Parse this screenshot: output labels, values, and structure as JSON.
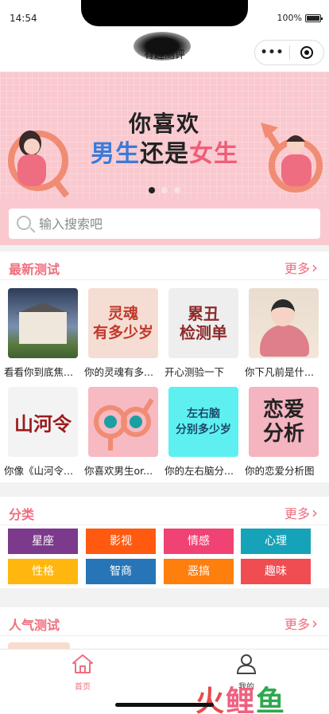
{
  "status": {
    "time": "14:54",
    "battery": "100%"
  },
  "nav": {
    "title": "有趣测评",
    "more_icon": "more-dots-icon",
    "close_icon": "target-circle-icon"
  },
  "banner": {
    "line1": "你喜欢",
    "line2": {
      "a": "男生",
      "b": "还是",
      "c": "女生"
    },
    "page_count": 3,
    "active_index": 0
  },
  "search": {
    "placeholder": "输入搜索吧",
    "value": ""
  },
  "latest": {
    "title": "最新测试",
    "more": "更多",
    "items": [
      {
        "caption": "看看你到底焦...",
        "thumb_text": ""
      },
      {
        "caption": "你的灵魂有多...",
        "thumb_text": "灵魂\n有多少岁"
      },
      {
        "caption": "开心测验一下",
        "thumb_text": "累丑\n检测单"
      },
      {
        "caption": "你下凡前是什...",
        "thumb_text": ""
      },
      {
        "caption": "你像《山河令...",
        "thumb_text": "山河令"
      },
      {
        "caption": "你喜欢男生or...",
        "thumb_text": ""
      },
      {
        "caption": "你的左右脑分...",
        "thumb_text": "左右脑\n分别多少岁"
      },
      {
        "caption": "你的恋爱分析图",
        "thumb_text": "恋爱\n分析"
      }
    ]
  },
  "category": {
    "title": "分类",
    "more": "更多",
    "items": [
      {
        "label": "星座",
        "color": "#7b3a8b"
      },
      {
        "label": "影视",
        "color": "#ff5a10"
      },
      {
        "label": "情感",
        "color": "#f04273"
      },
      {
        "label": "心理",
        "color": "#16a2b8"
      },
      {
        "label": "性格",
        "color": "#ffb70f"
      },
      {
        "label": "智商",
        "color": "#2775b6"
      },
      {
        "label": "恶搞",
        "color": "#ff7f0e"
      },
      {
        "label": "趣味",
        "color": "#ef4d52"
      }
    ]
  },
  "popular": {
    "title": "人气测试",
    "more": "更多"
  },
  "tabs": [
    {
      "label": "首页",
      "icon": "home-icon",
      "active": true,
      "color": "#ef6e7e"
    },
    {
      "label": "我的",
      "icon": "user-icon",
      "active": false,
      "color": "#444444"
    }
  ],
  "watermark": {
    "a": "火",
    "b": "鲤",
    "c": "鱼"
  }
}
